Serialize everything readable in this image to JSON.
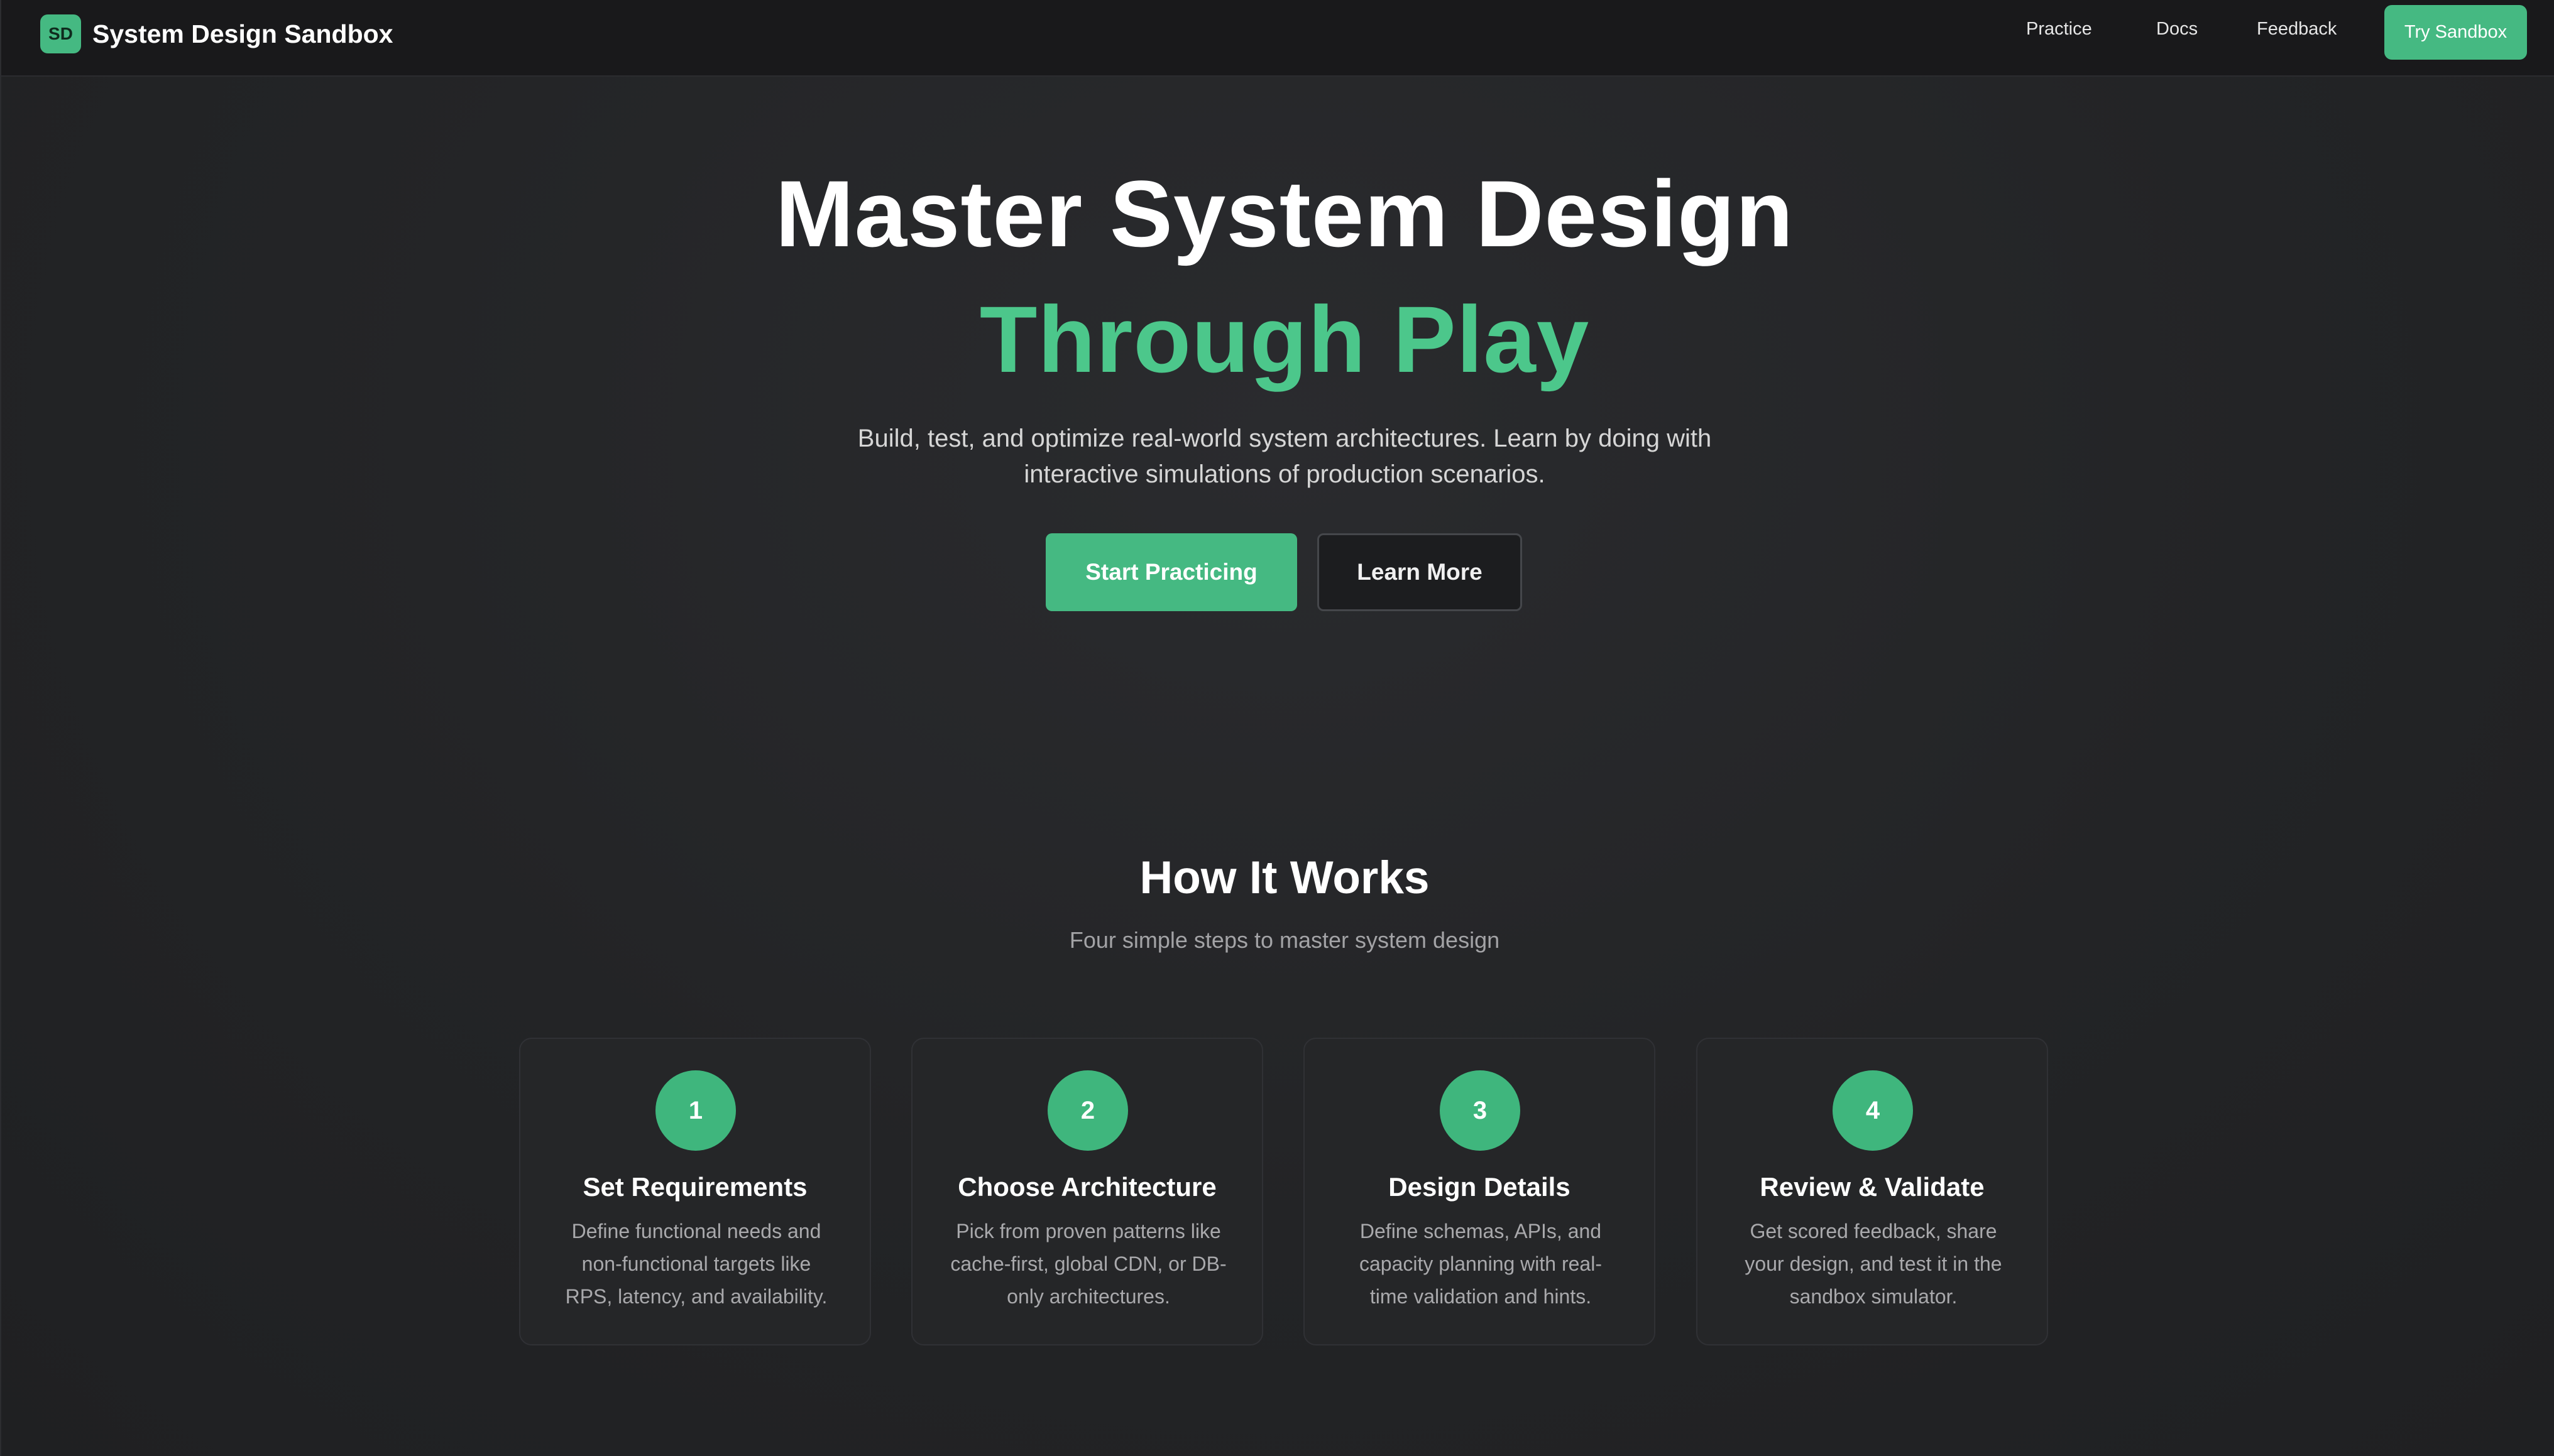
{
  "nav": {
    "logo_text": "SD",
    "brand": "System Design Sandbox",
    "links": [
      "Practice",
      "Docs",
      "Feedback"
    ],
    "cta": "Try Sandbox"
  },
  "hero": {
    "title_line1": "Master System Design",
    "title_line2": "Through Play",
    "subtitle_line1": "Build, test, and optimize real-world system architectures. Learn by doing with",
    "subtitle_line2": "interactive simulations of production scenarios.",
    "primary_button": "Start Practicing",
    "secondary_button": "Learn More"
  },
  "how": {
    "title": "How It Works",
    "subtitle": "Four simple steps to master system design",
    "steps": [
      {
        "number": "1",
        "title": "Set Requirements",
        "desc": [
          "Define functional needs and",
          "non-functional targets like",
          "RPS, latency, and availability."
        ]
      },
      {
        "number": "2",
        "title": "Choose Architecture",
        "desc": [
          "Pick from proven patterns like",
          "cache-first, global CDN, or DB-",
          "only architectures."
        ]
      },
      {
        "number": "3",
        "title": "Design Details",
        "desc": [
          "Define schemas, APIs, and",
          "capacity planning with real-",
          "time validation and hints."
        ]
      },
      {
        "number": "4",
        "title": "Review & Validate",
        "desc": [
          "Get scored feedback, share",
          "your design, and test it in the",
          "sandbox simulator."
        ]
      }
    ]
  },
  "colors": {
    "accent": "#45b982",
    "accent_text": "#4cc78b",
    "background": "#232426",
    "nav_background": "#19191b"
  }
}
